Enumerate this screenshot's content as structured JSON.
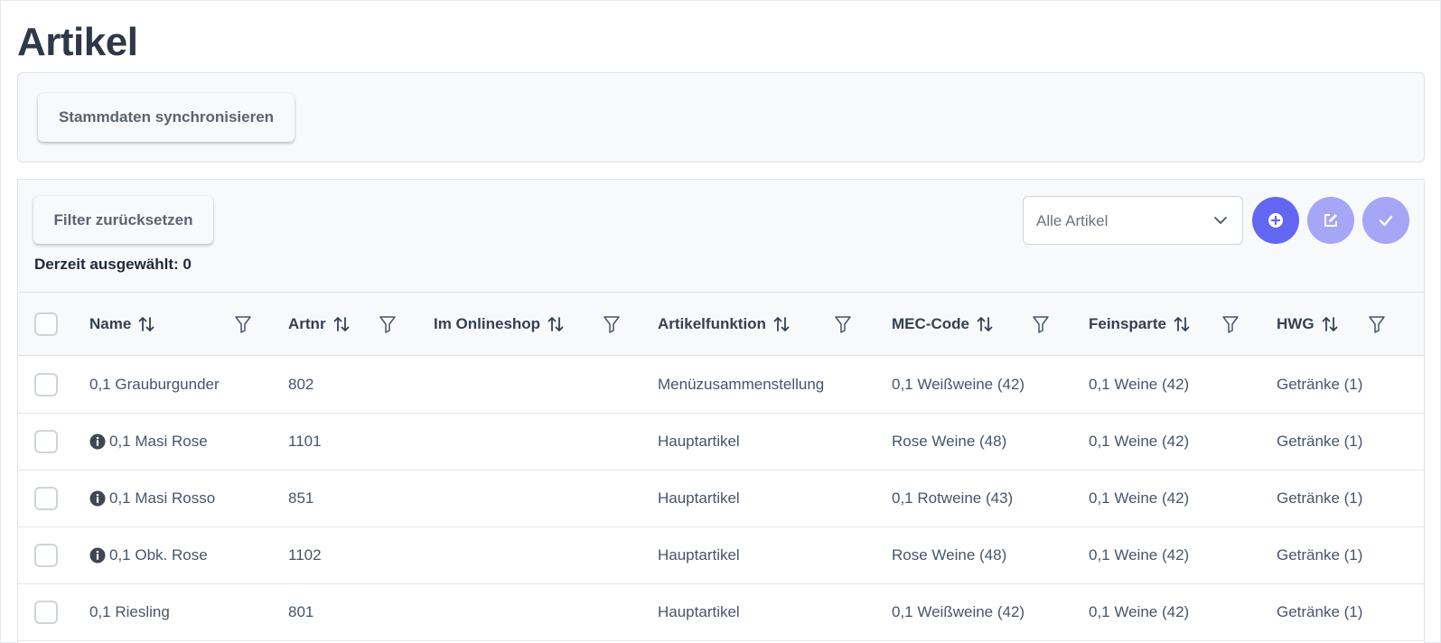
{
  "page": {
    "title": "Artikel"
  },
  "toolbar": {
    "sync_label": "Stammdaten synchronisieren"
  },
  "filters": {
    "reset_label": "Filter zurücksetzen",
    "selected_text": "Derzeit ausgewählt: 0",
    "dropdown_value": "Alle Artikel"
  },
  "actions": {
    "add_icon": "plus-circle-icon",
    "edit_icon": "edit-icon",
    "confirm_icon": "check-icon"
  },
  "colors": {
    "primary": "#6366f1",
    "primary_light": "#a5a6f6",
    "panel_bg": "#f8f9fa",
    "text_dark": "#2f3847"
  },
  "table": {
    "columns": [
      "Name",
      "Artnr",
      "Im Onlineshop",
      "Artikelfunktion",
      "MEC-Code",
      "Feinsparte",
      "HWG"
    ],
    "rows": [
      {
        "info": false,
        "name": "0,1 Grauburgunder",
        "artnr": "802",
        "onlineshop": "",
        "funktion": "Menüzusammenstellung",
        "mec": "0,1 Weißweine (42)",
        "feinsparte": "0,1 Weine (42)",
        "hwg": "Getränke (1)"
      },
      {
        "info": true,
        "name": "0,1 Masi Rose",
        "artnr": "1101",
        "onlineshop": "",
        "funktion": "Hauptartikel",
        "mec": "Rose Weine (48)",
        "feinsparte": "0,1 Weine (42)",
        "hwg": "Getränke (1)"
      },
      {
        "info": true,
        "name": "0,1 Masi Rosso",
        "artnr": "851",
        "onlineshop": "",
        "funktion": "Hauptartikel",
        "mec": "0,1 Rotweine (43)",
        "feinsparte": "0,1 Weine (42)",
        "hwg": "Getränke (1)"
      },
      {
        "info": true,
        "name": "0,1 Obk. Rose",
        "artnr": "1102",
        "onlineshop": "",
        "funktion": "Hauptartikel",
        "mec": "Rose Weine (48)",
        "feinsparte": "0,1 Weine (42)",
        "hwg": "Getränke (1)"
      },
      {
        "info": false,
        "name": "0,1 Riesling",
        "artnr": "801",
        "onlineshop": "",
        "funktion": "Hauptartikel",
        "mec": "0,1 Weißweine (42)",
        "feinsparte": "0,1 Weine (42)",
        "hwg": "Getränke (1)"
      }
    ]
  }
}
